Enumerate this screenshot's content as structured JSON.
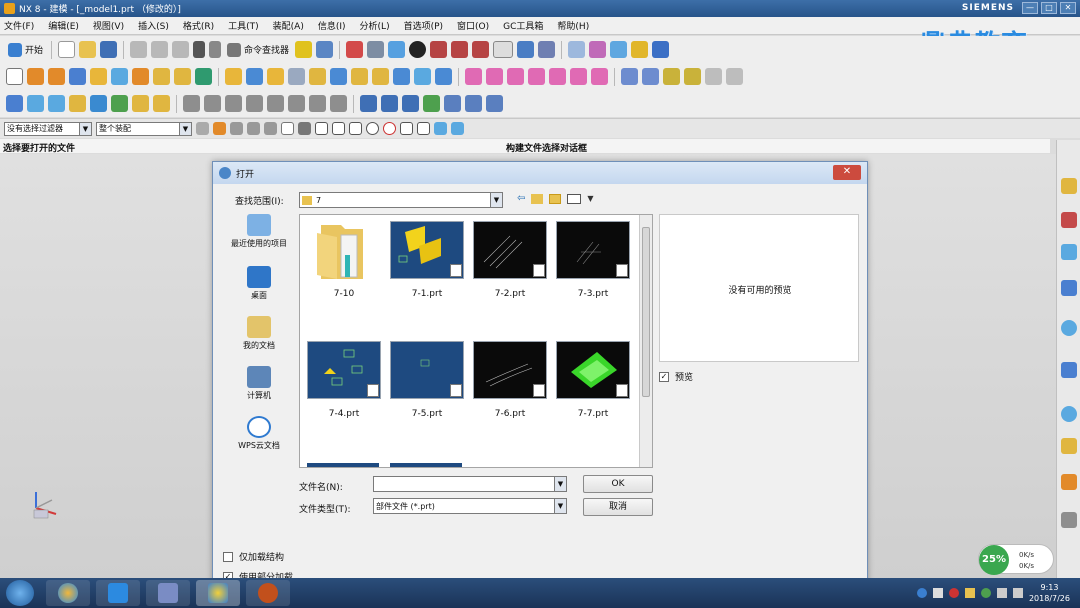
{
  "window": {
    "title": "NX 8 - 建模 - [_model1.prt （修改的）]",
    "brand": "SIEMENS",
    "buttons": [
      "—",
      "□",
      "✕"
    ]
  },
  "menu": [
    "文件(F)",
    "编辑(E)",
    "视图(V)",
    "插入(S)",
    "格式(R)",
    "工具(T)",
    "装配(A)",
    "信息(I)",
    "分析(L)",
    "首选项(P)",
    "窗口(O)",
    "GC工具箱",
    "帮助(H)"
  ],
  "logo_text": "鼎典教育",
  "toolbar": {
    "start_label": "开始",
    "command_finder_label": "命令查找器"
  },
  "filterbar": {
    "type_filter": "没有选择过滤器",
    "scope": "整个装配"
  },
  "statusline": {
    "prompt": "选择要打开的文件",
    "dialog_hint": "构建文件选择对话框"
  },
  "dialog": {
    "title": "打开",
    "close": "✕",
    "lookin_label": "查找范围(I):",
    "lookin_value": "7",
    "places": [
      "最近使用的项目",
      "桌面",
      "我的文档",
      "计算机",
      "WPS云文档"
    ],
    "files": [
      {
        "name": "7-10",
        "kind": "folder"
      },
      {
        "name": "7-1.prt",
        "kind": "part"
      },
      {
        "name": "7-2.prt",
        "kind": "part"
      },
      {
        "name": "7-3.prt",
        "kind": "part"
      },
      {
        "name": "7-4.prt",
        "kind": "part"
      },
      {
        "name": "7-5.prt",
        "kind": "part"
      },
      {
        "name": "7-6.prt",
        "kind": "part"
      },
      {
        "name": "7-7.prt",
        "kind": "part"
      }
    ],
    "preview_none": "没有可用的预览",
    "preview_label": "预览",
    "filename_label": "文件名(N):",
    "filename_value": "",
    "filetype_label": "文件类型(T):",
    "filetype_value": "部件文件 (*.prt)",
    "ok": "OK",
    "cancel": "取消",
    "option_partial_structure": "仅加载结构",
    "option_partial_load": "使用部分加载"
  },
  "network": {
    "percent": "25%",
    "up": "0K/s",
    "down": "0K/s"
  },
  "clock": {
    "time": "9:13",
    "date": "2018/7/26"
  },
  "colors": {
    "title_bar": "#27548a",
    "logo": "#2a8be0",
    "dialog_border": "#6f8fb8",
    "taskbar": "#1a3357"
  }
}
